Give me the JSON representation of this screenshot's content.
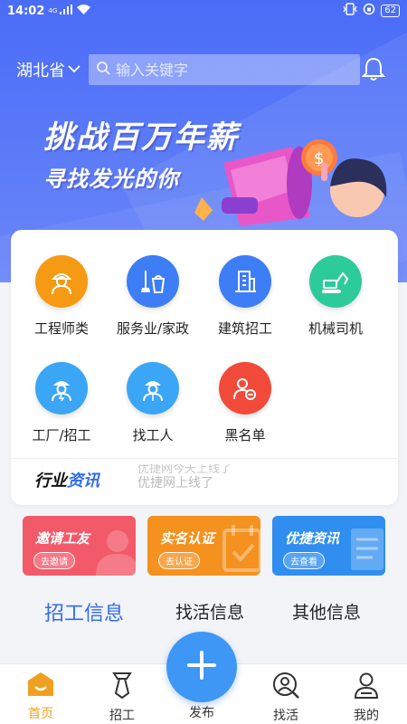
{
  "status_bar": {
    "time": "14:02",
    "network": "4G",
    "battery": "62"
  },
  "header": {
    "province": "湖北省",
    "search_placeholder": "输入关键字"
  },
  "banner": {
    "title": "挑战百万年薪",
    "subtitle": "寻找发光的你",
    "coin_symbol": "$"
  },
  "categories": [
    {
      "label": "工程师类",
      "color": "#f59a12",
      "icon": "worker-icon"
    },
    {
      "label": "服务业/家政",
      "color": "#3d7df5",
      "icon": "cleaning-icon"
    },
    {
      "label": "建筑招工",
      "color": "#3d7df5",
      "icon": "building-icon"
    },
    {
      "label": "机械司机",
      "color": "#2ecb9a",
      "icon": "excavator-icon"
    },
    {
      "label": "工厂/招工",
      "color": "#3aa6f5",
      "icon": "factory-worker-icon"
    },
    {
      "label": "找工人",
      "color": "#3aa6f5",
      "icon": "find-worker-icon"
    },
    {
      "label": "黑名单",
      "color": "#f24a3a",
      "icon": "blacklist-icon"
    }
  ],
  "news": {
    "title_part1": "行业",
    "title_part2": "资讯",
    "line1": "优捷网今天上线了",
    "line2": "优捷网上线了"
  },
  "promos": [
    {
      "title": "邀请工友",
      "button": "去邀请",
      "color": "#f25a6a"
    },
    {
      "title": "实名认证",
      "button": "去认证",
      "color": "#f5911e"
    },
    {
      "title": "优捷资讯",
      "button": "去查看",
      "color": "#2f8ef0"
    }
  ],
  "info_tabs": [
    "招工信息",
    "找活信息",
    "其他信息"
  ],
  "bottom_nav": {
    "home": "首页",
    "recruit": "招工",
    "publish": "发布",
    "find_work": "找活",
    "mine": "我的"
  },
  "colors": {
    "accent": "#2f6bf0",
    "active_nav": "#f0a020",
    "hero": "#4a6cf7"
  }
}
